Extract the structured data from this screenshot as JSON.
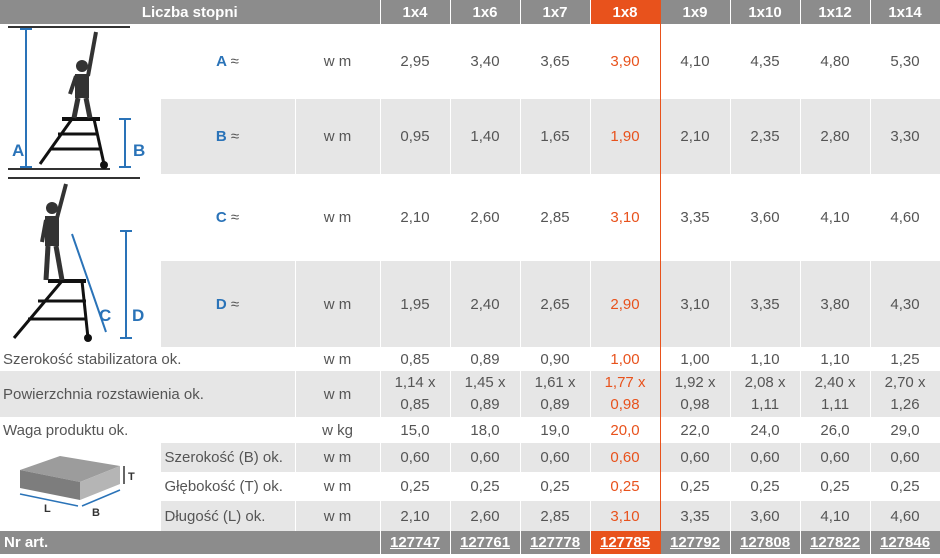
{
  "header": {
    "label": "Liczba stopni",
    "columns": [
      "1x4",
      "1x6",
      "1x7",
      "1x8",
      "1x9",
      "1x10",
      "1x12",
      "1x14"
    ],
    "selected_index": 3,
    "accent_color": "#e8521c",
    "header_bg": "#8c8c8c"
  },
  "diagram_letters": {
    "A": "A",
    "B": "B",
    "C": "C",
    "D": "D",
    "T": "T",
    "L": "L",
    "B2": "B"
  },
  "rows": [
    {
      "label": "A",
      "approx": "≈",
      "unit": "w m",
      "values": [
        "2,95",
        "3,40",
        "3,65",
        "3,90",
        "4,10",
        "4,35",
        "4,80",
        "5,30"
      ]
    },
    {
      "label": "B",
      "approx": "≈",
      "unit": "w m",
      "values": [
        "0,95",
        "1,40",
        "1,65",
        "1,90",
        "2,10",
        "2,35",
        "2,80",
        "3,30"
      ]
    },
    {
      "label": "C",
      "approx": "≈",
      "unit": "w m",
      "values": [
        "2,10",
        "2,60",
        "2,85",
        "3,10",
        "3,35",
        "3,60",
        "4,10",
        "4,60"
      ]
    },
    {
      "label": "D",
      "approx": "≈",
      "unit": "w m",
      "values": [
        "1,95",
        "2,40",
        "2,65",
        "2,90",
        "3,10",
        "3,35",
        "3,80",
        "4,30"
      ]
    },
    {
      "label": "Szerokość stabilizatora ok.",
      "unit": "w m",
      "values": [
        "0,85",
        "0,89",
        "0,90",
        "1,00",
        "1,00",
        "1,10",
        "1,10",
        "1,25"
      ]
    },
    {
      "label": "Powierzchnia rozstawienia ok.",
      "unit": "w m",
      "values_top": [
        "1,14 x",
        "1,45 x",
        "1,61 x",
        "1,77 x",
        "1,92 x",
        "2,08 x",
        "2,40 x",
        "2,70 x"
      ],
      "values_bottom": [
        "0,85",
        "0,89",
        "0,89",
        "0,98",
        "0,98",
        "1,11",
        "1,11",
        "1,26"
      ]
    },
    {
      "label": "Waga produktu ok.",
      "unit": "w kg",
      "values": [
        "15,0",
        "18,0",
        "19,0",
        "20,0",
        "22,0",
        "24,0",
        "26,0",
        "29,0"
      ]
    },
    {
      "label": "Szerokość (B) ok.",
      "unit": "w m",
      "values": [
        "0,60",
        "0,60",
        "0,60",
        "0,60",
        "0,60",
        "0,60",
        "0,60",
        "0,60"
      ]
    },
    {
      "label": "Głębokość (T) ok.",
      "unit": "w m",
      "values": [
        "0,25",
        "0,25",
        "0,25",
        "0,25",
        "0,25",
        "0,25",
        "0,25",
        "0,25"
      ]
    },
    {
      "label": "Długość (L) ok.",
      "unit": "w m",
      "values": [
        "2,10",
        "2,60",
        "2,85",
        "3,10",
        "3,35",
        "3,60",
        "4,10",
        "4,60"
      ]
    }
  ],
  "footer": {
    "label": "Nr art.",
    "values": [
      "127747",
      "127761",
      "127778",
      "127785",
      "127792",
      "127808",
      "127822",
      "127846"
    ]
  }
}
